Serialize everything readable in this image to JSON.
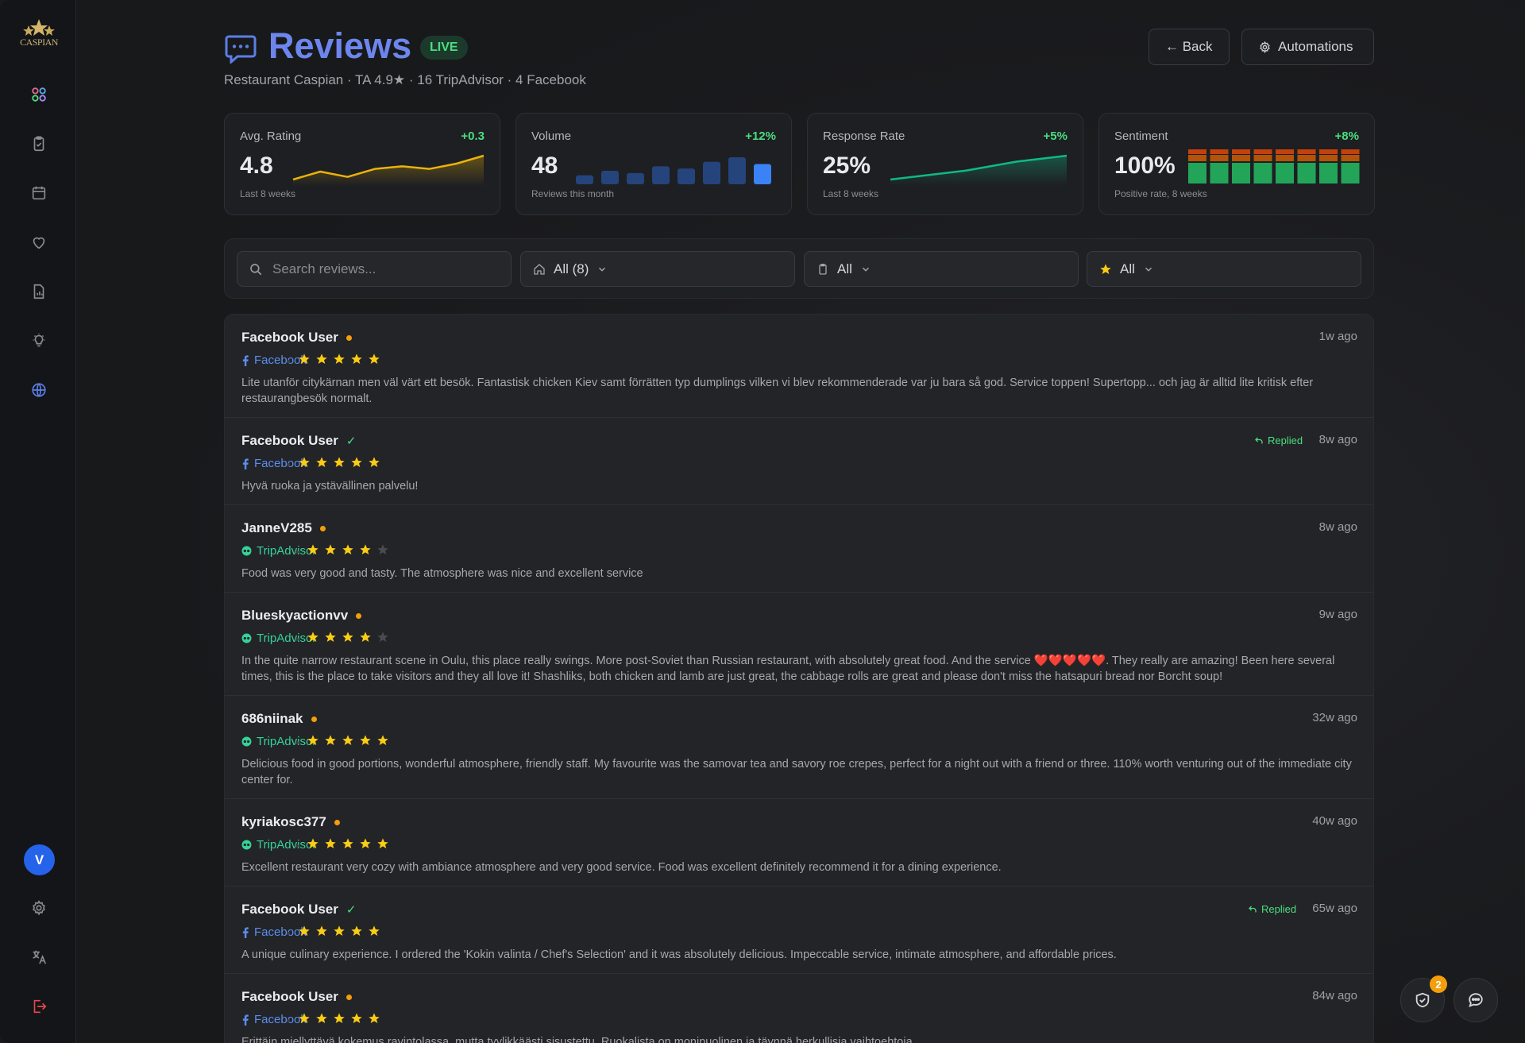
{
  "app": {
    "logo_text": "CASPIAN"
  },
  "header": {
    "title": "Reviews",
    "live_badge": "LIVE",
    "subtitle": "Restaurant Caspian · TA 4.9★ · 16 TripAdvisor · 4 Facebook",
    "back_label": "← Back",
    "automations_label": "Automations"
  },
  "stats": {
    "avg_rating": {
      "label": "Avg. Rating",
      "delta": "+0.3",
      "value": "4.8",
      "caption": "Last 8 weeks",
      "trend": [
        4.3,
        4.45,
        4.35,
        4.5,
        4.55,
        4.5,
        4.6,
        4.75
      ]
    },
    "volume": {
      "label": "Volume",
      "delta": "+12%",
      "value": "48",
      "caption": "Reviews this month",
      "bars": [
        2,
        3,
        2.5,
        4,
        3.5,
        5,
        6,
        4.5
      ]
    },
    "response_rate": {
      "label": "Response Rate",
      "delta": "+5%",
      "value": "25%",
      "caption": "Last 8 weeks",
      "trend": [
        10,
        12,
        14,
        16,
        19,
        22,
        24,
        26
      ]
    },
    "sentiment": {
      "label": "Sentiment",
      "delta": "+8%",
      "value": "100%",
      "caption": "Positive rate, 8 weeks",
      "positive_rate": [
        1,
        1,
        1,
        1,
        1,
        1,
        1,
        1
      ]
    }
  },
  "filters": {
    "search_placeholder": "Search reviews...",
    "source_value": "All (8)",
    "status_value": "All",
    "rating_value": "All"
  },
  "reviews": [
    {
      "author": "Facebook User",
      "status": "pending",
      "source": "Facebook",
      "rating": 5,
      "replied": "",
      "time": "1w ago",
      "text": "Lite utanför citykärnan men väl värt ett besök. Fantastisk chicken Kiev samt förrätten typ dumplings vilken vi blev rekommenderade var ju bara så god. Service toppen! Supertopp... och jag är alltid lite kritisk efter restaurangbesök normalt."
    },
    {
      "author": "Facebook User",
      "status": "replied",
      "source": "Facebook",
      "rating": 5,
      "replied": "Replied",
      "time": "8w ago",
      "text": "Hyvä ruoka ja ystävällinen palvelu!"
    },
    {
      "author": "JanneV285",
      "status": "pending",
      "source": "TripAdvisor",
      "rating": 4,
      "replied": "",
      "time": "8w ago",
      "text": "Food was very good and tasty. The atmosphere was nice and excellent service"
    },
    {
      "author": "Blueskyactionvv",
      "status": "pending",
      "source": "TripAdvisor",
      "rating": 4,
      "replied": "",
      "time": "9w ago",
      "text": "In the quite narrow restaurant scene in Oulu, this place really swings. More post-Soviet than Russian restaurant, with absolutely great food. And the service ❤️❤️❤️❤️❤️. They really are amazing! Been here several times, this is the place to take visitors and they all love it! Shashliks, both chicken and lamb are just great, the cabbage rolls are great and please don't miss the hatsapuri bread nor Borcht soup!"
    },
    {
      "author": "686niinak",
      "status": "pending",
      "source": "TripAdvisor",
      "rating": 5,
      "replied": "",
      "time": "32w ago",
      "text": "Delicious food in good portions, wonderful atmosphere, friendly staff. My favourite was the samovar tea and savory roe crepes, perfect for a night out with a friend or three. 110% worth venturing out of the immediate city center for."
    },
    {
      "author": "kyriakosc377",
      "status": "pending",
      "source": "TripAdvisor",
      "rating": 5,
      "replied": "",
      "time": "40w ago",
      "text": "Excellent restaurant very cozy with ambiance atmosphere and very good service. Food was excellent definitely recommend it for a dining experience."
    },
    {
      "author": "Facebook User",
      "status": "replied",
      "source": "Facebook",
      "rating": 5,
      "replied": "Replied",
      "time": "65w ago",
      "text": "A unique culinary experience. I ordered the 'Kokin valinta / Chef's Selection' and it was absolutely delicious. Impeccable service, intimate atmosphere, and affordable prices."
    },
    {
      "author": "Facebook User",
      "status": "pending",
      "source": "Facebook",
      "rating": 5,
      "replied": "",
      "time": "84w ago",
      "text": "Erittäin miellyttävä kokemus ravintolassa, mutta tyylikkäästi sisustettu. Ruokalista on monipuolinen ja täynnä herkullisia vaihtoehtoja."
    }
  ],
  "fab": {
    "badge_count": "2"
  },
  "colors": {
    "accent": "#6d86ee",
    "positive": "#4ade80",
    "warning": "#f59e0b",
    "star": "#facc15",
    "facebook": "#5b8def",
    "tripadvisor": "#34d399"
  }
}
